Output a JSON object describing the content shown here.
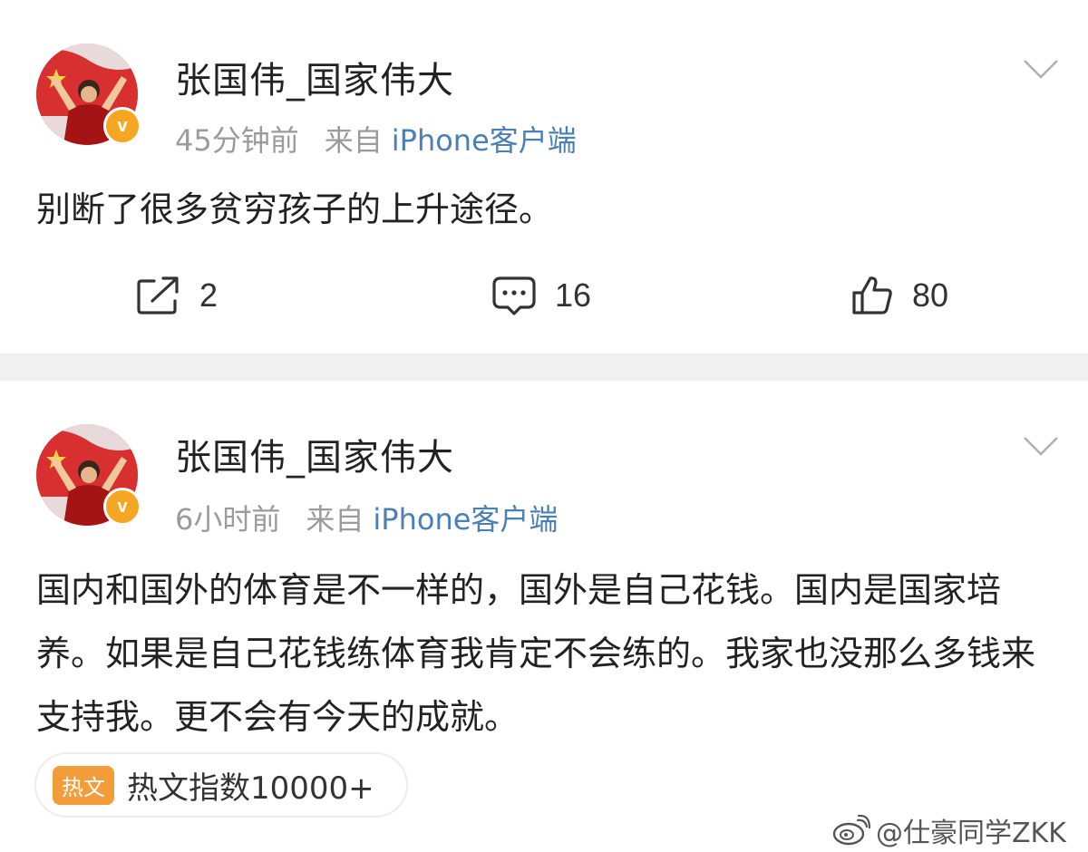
{
  "posts": [
    {
      "username": "张国伟_国家伟大",
      "time": "45分钟前",
      "source_prefix": "来自",
      "source": "iPhone客户端",
      "text": "别断了很多贫穷孩子的上升途径。",
      "actions": {
        "share": "2",
        "comment": "16",
        "like": "80"
      }
    },
    {
      "username": "张国伟_国家伟大",
      "time": "6小时前",
      "source_prefix": "来自",
      "source": "iPhone客户端",
      "text": "国内和国外的体育是不一样的，国外是自己花钱。国内是国家培养。如果是自己花钱练体育我肯定不会练的。我家也没那么多钱来支持我。更不会有今天的成就。",
      "hot": {
        "tag": "热文",
        "text": "热文指数10000+"
      }
    }
  ],
  "verify_badge": "v",
  "watermark": "@仕豪同学ZKK",
  "colors": {
    "source_link": "#4b7fb8",
    "verify_badge": "#f5a623",
    "hot_tag": "#f39c3a",
    "separator": "#f0f0f0"
  },
  "icons": [
    "chevron-down-icon",
    "share-icon",
    "comment-icon",
    "like-icon",
    "weibo-logo-icon"
  ]
}
